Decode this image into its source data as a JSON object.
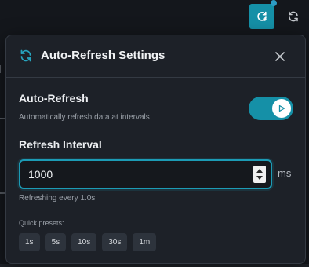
{
  "topbar": {
    "refresh_settings_icon": "refresh-settings-icon",
    "refresh_icon": "refresh-icon",
    "accent": "#1590a7"
  },
  "panel": {
    "title": "Auto-Refresh Settings",
    "auto_refresh": {
      "title": "Auto-Refresh",
      "description": "Automatically refresh data at intervals",
      "enabled": true
    },
    "interval": {
      "title": "Refresh Interval",
      "value": "1000",
      "unit": "ms",
      "hint": "Refreshing every 1.0s"
    },
    "presets": {
      "label": "Quick presets:",
      "items": [
        "1s",
        "5s",
        "10s",
        "30s",
        "1m"
      ]
    }
  },
  "colors": {
    "accent": "#1590a7",
    "panel_bg": "#1d2128",
    "page_bg": "#14171c"
  }
}
